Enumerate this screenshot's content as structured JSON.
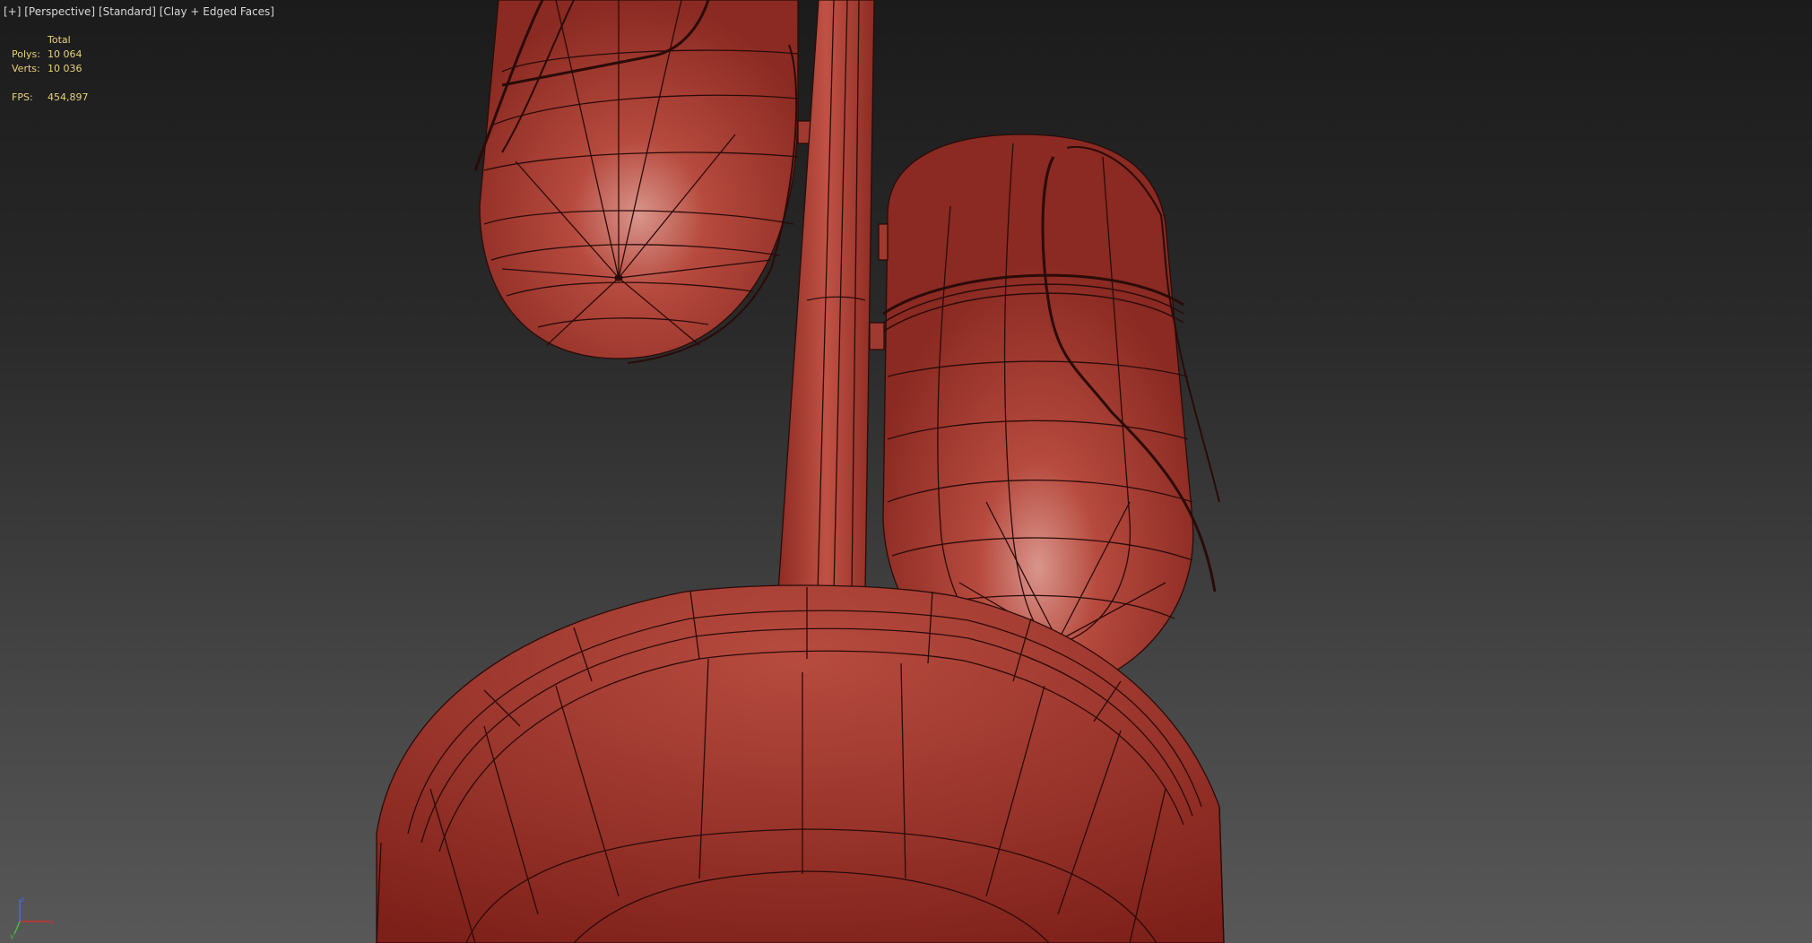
{
  "viewport": {
    "label_plus": "[+]",
    "label_view": "[Perspective]",
    "label_shading": "[Standard]",
    "label_mode": "[Clay + Edged Faces]"
  },
  "stats": {
    "header": "Total",
    "polys_label": "Polys:",
    "polys_value": "10 064",
    "verts_label": "Verts:",
    "verts_value": "10 036",
    "fps_label": "FPS:",
    "fps_value": "454,897"
  },
  "axis": {
    "x": "x",
    "y": "y",
    "z": "z",
    "x_color": "#d03030",
    "y_color": "#40c040",
    "z_color": "#4a6ae0"
  },
  "colors": {
    "clay": "#b94a3e",
    "edge": "#2a0b08",
    "text": "#e8d27a"
  }
}
